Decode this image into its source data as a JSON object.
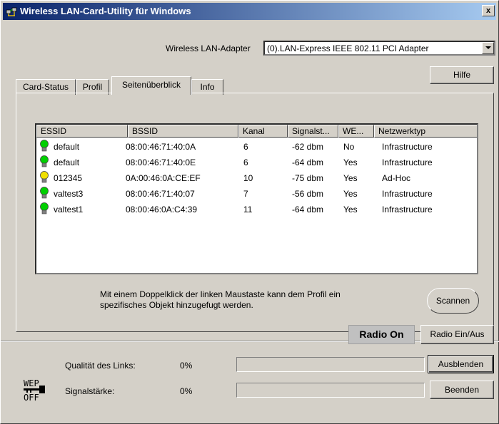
{
  "window": {
    "title": "Wireless LAN-Card-Utility für Windows",
    "close_label": "x"
  },
  "adapter": {
    "label": "Wireless LAN-Adapter",
    "selected": "(0).LAN-Express IEEE 802.11 PCI Adapter"
  },
  "help_button": "Hilfe",
  "tabs": [
    {
      "label": "Card-Status",
      "active": false
    },
    {
      "label": "Profil",
      "active": false
    },
    {
      "label": "Seitenüberblick",
      "active": true
    },
    {
      "label": "Info",
      "active": false
    }
  ],
  "networks": {
    "columns": [
      "ESSID",
      "BSSID",
      "Kanal",
      "Signalst...",
      "WE...",
      "Netzwerktyp"
    ],
    "rows": [
      {
        "essid": "default",
        "bssid": "08:00:46:71:40:0A",
        "kanal": "6",
        "signal": "-62 dbm",
        "wep": "No",
        "typ": "Infrastructure",
        "bulb": "#00d000"
      },
      {
        "essid": "default",
        "bssid": "08:00:46:71:40:0E",
        "kanal": "6",
        "signal": "-64 dbm",
        "wep": "Yes",
        "typ": "Infrastructure",
        "bulb": "#00d000"
      },
      {
        "essid": "012345",
        "bssid": "0A:00:46:0A:CE:EF",
        "kanal": "10",
        "signal": "-75 dbm",
        "wep": "Yes",
        "typ": "Ad-Hoc",
        "bulb": "#f0e000"
      },
      {
        "essid": "valtest3",
        "bssid": "08:00:46:71:40:07",
        "kanal": "7",
        "signal": "-56 dbm",
        "wep": "Yes",
        "typ": "Infrastructure",
        "bulb": "#00d000"
      },
      {
        "essid": "valtest1",
        "bssid": "08:00:46:0A:C4:39",
        "kanal": "11",
        "signal": "-64 dbm",
        "wep": "Yes",
        "typ": "Infrastructure",
        "bulb": "#00d000"
      }
    ]
  },
  "hint": {
    "line1": "Mit einem Doppelklick der linken Maustaste kann dem Profil ein",
    "line2": "spezifisches Objekt hinzugefugt werden."
  },
  "scan_button": "Scannen",
  "radio": {
    "status": "Radio On",
    "toggle_button": "Radio Ein/Aus"
  },
  "link_quality": {
    "label": "Qualität des Links:",
    "value": "0%",
    "level": 0
  },
  "signal_strength": {
    "label": "Signalstärke:",
    "value": "0%",
    "level": 0
  },
  "wep_badge": {
    "line1": "WEP",
    "line2": "OFF"
  },
  "hide_button": "Ausblenden",
  "exit_button": "Beenden"
}
